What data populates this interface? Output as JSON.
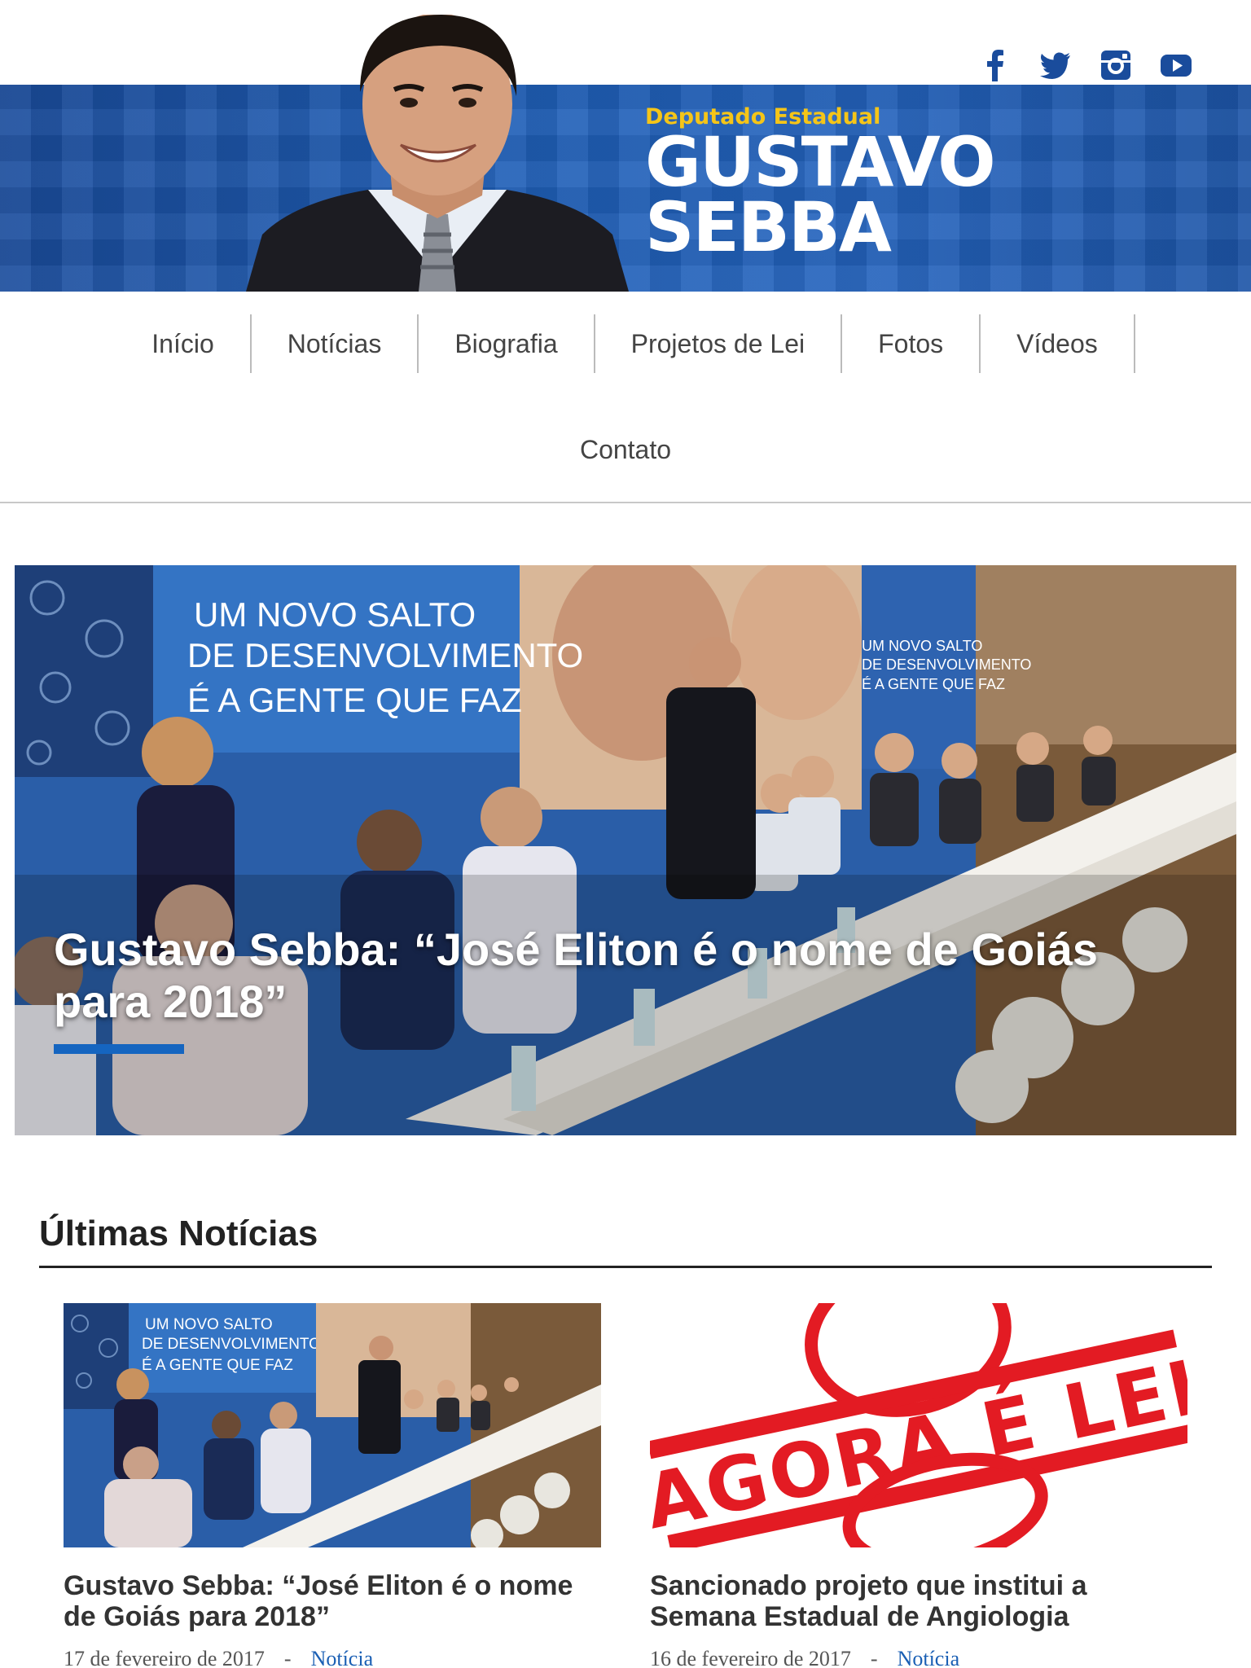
{
  "header": {
    "subtitle": "Deputado Estadual",
    "name_line1": "GUSTAVO",
    "name_line2": "SEBBA",
    "social": [
      "facebook-icon",
      "twitter-icon",
      "instagram-icon",
      "youtube-icon"
    ],
    "colors": {
      "banner": "#1f5fb7",
      "subtitle": "#f5c518"
    }
  },
  "nav": {
    "items": [
      "Início",
      "Notícias",
      "Biografia",
      "Projetos de Lei",
      "Fotos",
      "Vídeos",
      "Contato"
    ]
  },
  "hero": {
    "title": "Gustavo Sebba: “José Eliton é o nome de Goiás para 2018”",
    "photo_text": [
      "UM NOVO SALTO",
      "DE DESENVOLVIMENTO",
      "É A GENTE QUE FAZ"
    ]
  },
  "latest": {
    "title": "Últimas Notícias",
    "cards": [
      {
        "title": "Gustavo Sebba: “José Eliton é o nome de Goiás para 2018”",
        "date": "17 de fevereiro de 2017",
        "separator": "-",
        "category": "Notícia"
      },
      {
        "title": "Sancionado projeto que institui a Semana Estadual de Angiologia",
        "date": "16 de fevereiro de 2017",
        "separator": "-",
        "category": "Notícia",
        "stamp_text": "AGORA É LEI"
      }
    ]
  }
}
